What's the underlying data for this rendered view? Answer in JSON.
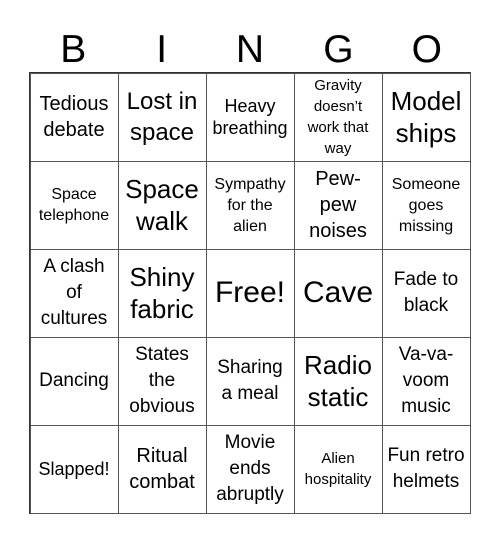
{
  "header": [
    "B",
    "I",
    "N",
    "G",
    "O"
  ],
  "cells": [
    [
      "Tedious debate",
      "Lost in space",
      "Heavy breathing",
      "Gravity doesn’t work that way",
      "Model ships"
    ],
    [
      "Space telephone",
      "Space walk",
      "Sympathy for the alien",
      "Pew-pew noises",
      "Someone goes missing"
    ],
    [
      "A clash of cultures",
      "Shiny fabric",
      "Free!",
      "Cave",
      "Fade to black"
    ],
    [
      "Dancing",
      "States the obvious",
      "Sharing a meal",
      "Radio static",
      "Va-va-voom music"
    ],
    [
      "Slapped!",
      "Ritual combat",
      "Movie ends abruptly",
      "Alien hospitality",
      "Fun retro helmets"
    ]
  ]
}
